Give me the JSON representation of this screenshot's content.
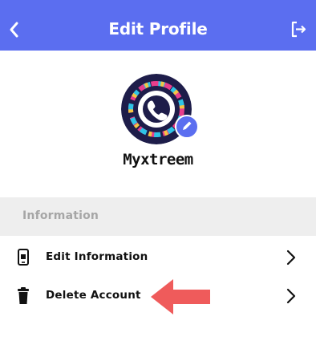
{
  "header": {
    "title": "Edit Profile",
    "back_icon": "chevron-left-icon",
    "logout_icon": "logout-icon",
    "background": "#5b6ef0"
  },
  "profile": {
    "username": "Myxtreem",
    "avatar_icon": "phone-handset-icon",
    "edit_icon": "pencil-icon"
  },
  "section": {
    "title": "Information"
  },
  "menu": [
    {
      "label": "Edit Information",
      "icon": "phone-device-icon",
      "action_icon": "chevron-right-icon"
    },
    {
      "label": "Delete Account",
      "icon": "trash-icon",
      "action_icon": "chevron-right-icon"
    }
  ],
  "annotation": {
    "icon": "red-arrow-left-icon",
    "color": "#ef5b5b"
  }
}
